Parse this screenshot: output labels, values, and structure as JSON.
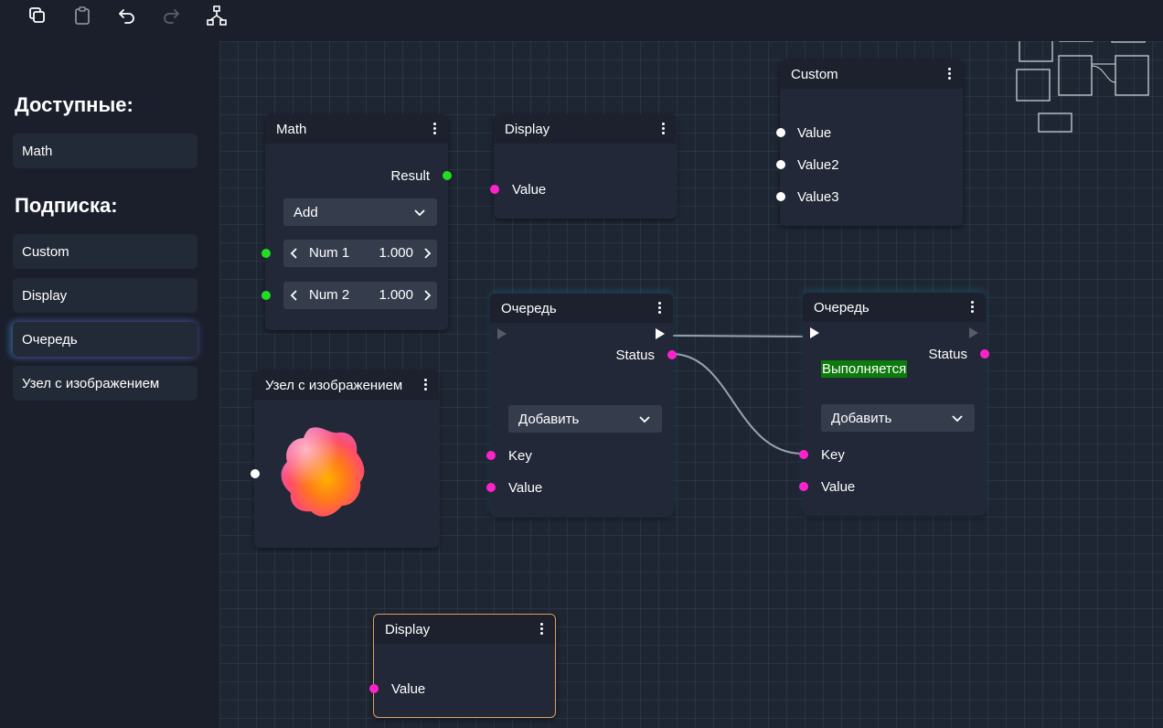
{
  "toolbar": {
    "icons": [
      "copy-icon",
      "clipboard-icon",
      "undo-icon",
      "redo-icon",
      "layout-icon"
    ]
  },
  "sidebar": {
    "available_heading": "Доступные:",
    "available_items": [
      {
        "label": "Math"
      }
    ],
    "subscription_heading": "Подписка:",
    "subscription_items": [
      {
        "label": "Custom"
      },
      {
        "label": "Display"
      },
      {
        "label": "Очередь"
      },
      {
        "label": "Узел с изображением"
      }
    ]
  },
  "nodes": {
    "math": {
      "title": "Math",
      "output": "Result",
      "operation": "Add",
      "num1_label": "Num 1",
      "num1_value": "1.000",
      "num2_label": "Num 2",
      "num2_value": "1.000"
    },
    "display_top": {
      "title": "Display",
      "input": "Value"
    },
    "custom": {
      "title": "Custom",
      "inputs": [
        "Value",
        "Value2",
        "Value3"
      ]
    },
    "queue_left": {
      "title": "Очередь",
      "status": "Status",
      "action": "Добавить",
      "key": "Key",
      "value": "Value"
    },
    "queue_right": {
      "title": "Очередь",
      "status": "Status",
      "state_badge": "Выполняется",
      "action": "Добавить",
      "key": "Key",
      "value": "Value"
    },
    "image_node": {
      "title": "Узел с изображением"
    },
    "display_bottom": {
      "title": "Display",
      "input": "Value"
    }
  },
  "colors": {
    "port_green": "#22dd22",
    "port_pink": "#ff22cc",
    "badge_green": "#0d7a0d",
    "selected_border": "#e0a060"
  }
}
